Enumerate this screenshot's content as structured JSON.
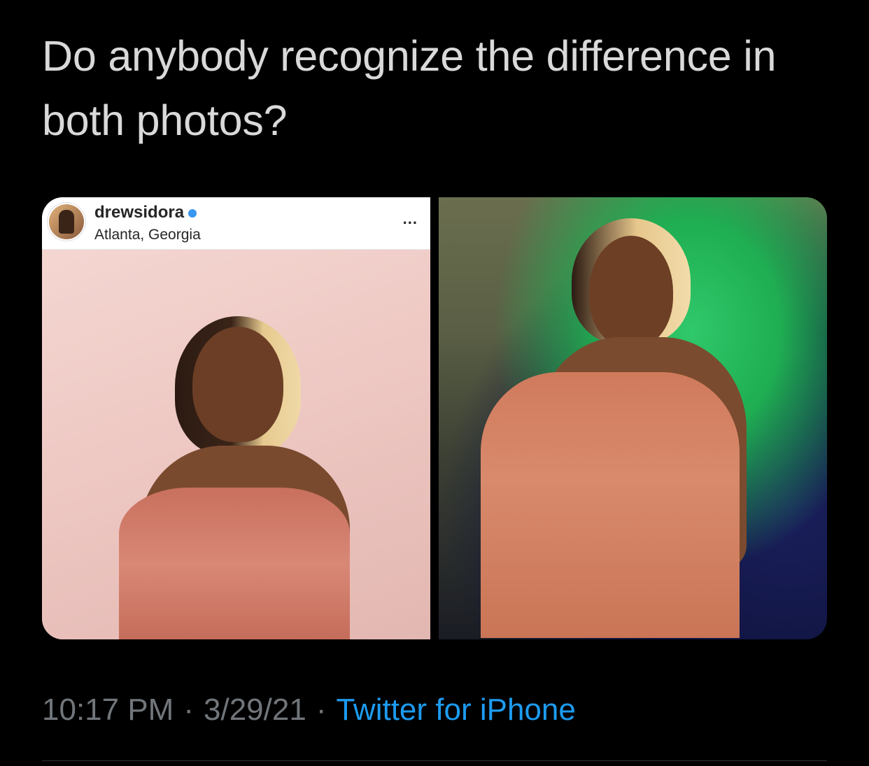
{
  "tweet": {
    "text": "Do anybody recognize the difference in both photos?",
    "time": "10:17 PM",
    "date": "3/29/21",
    "separator": "·",
    "source": "Twitter for iPhone"
  },
  "media": {
    "left": {
      "username": "drewsidora",
      "location": "Atlanta, Georgia",
      "more": "..."
    }
  },
  "colors": {
    "background": "#000000",
    "text": "#d9d9d9",
    "meta": "#71767b",
    "link": "#1d9bf0"
  }
}
